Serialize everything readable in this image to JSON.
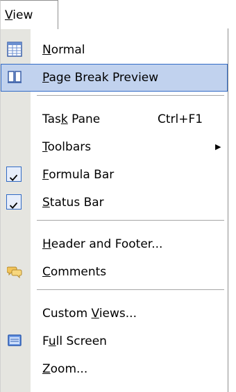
{
  "menu": {
    "title": "View",
    "items": [
      {
        "label": "Normal",
        "accel": "N",
        "icon": "normal-view-icon"
      },
      {
        "label": "Page Break Preview",
        "accel": "P",
        "icon": "page-break-preview-icon",
        "highlighted": true
      },
      {
        "label": "Task Pane",
        "accel": "k",
        "shortcut": "Ctrl+F1"
      },
      {
        "label": "Toolbars",
        "accel": "T",
        "submenu": true
      },
      {
        "label": "Formula Bar",
        "accel": "F",
        "checked": true
      },
      {
        "label": "Status Bar",
        "accel": "S",
        "checked": true
      },
      {
        "label": "Header and Footer...",
        "accel": "H"
      },
      {
        "label": "Comments",
        "accel": "C",
        "icon": "comments-icon"
      },
      {
        "label": "Custom Views...",
        "accel": "V"
      },
      {
        "label": "Full Screen",
        "accel": "u",
        "icon": "full-screen-icon"
      },
      {
        "label": "Zoom...",
        "accel": "Z"
      }
    ]
  },
  "colors": {
    "highlight": "#c1d2ee",
    "highlight_border": "#316ac5",
    "icon_strip": "#e5e5e0"
  }
}
